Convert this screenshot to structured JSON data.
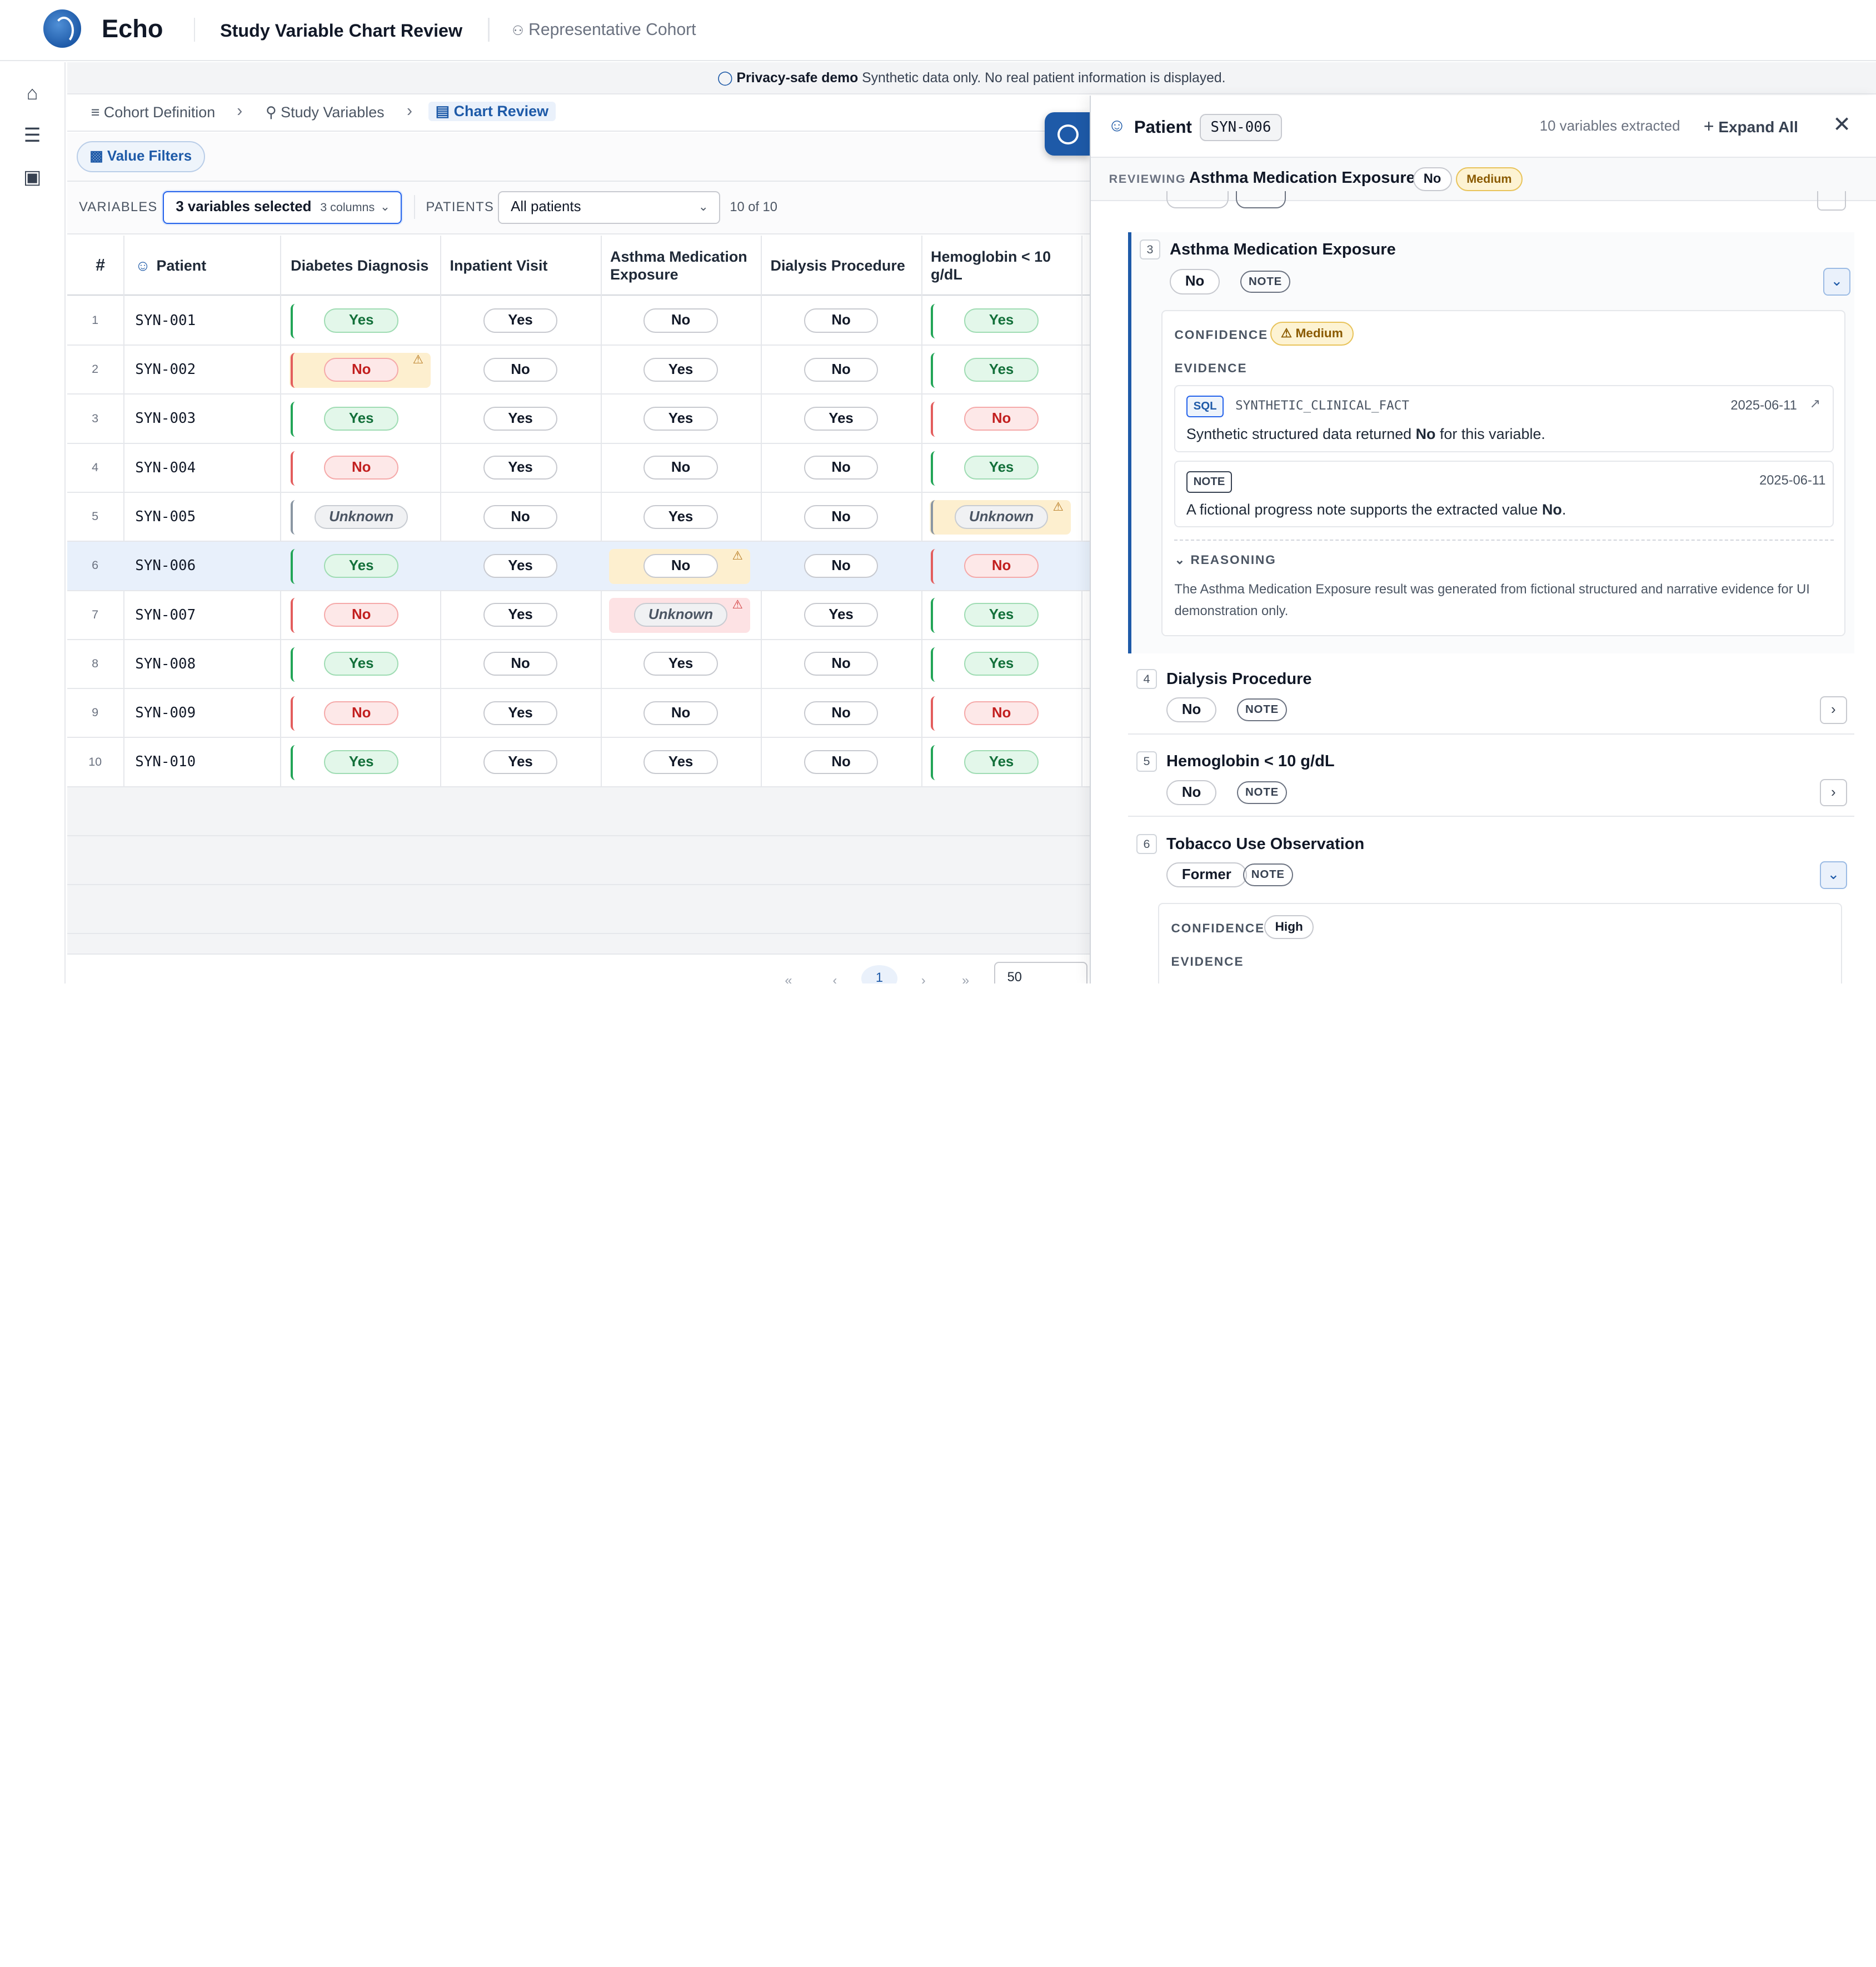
{
  "header": {
    "brand": "Echo",
    "title": "Study Variable Chart Review",
    "cohort": "Representative Cohort"
  },
  "rail": {
    "icons": [
      "home-icon",
      "list-icon",
      "briefcase-icon"
    ]
  },
  "banner": {
    "bold": "Privacy-safe demo",
    "text": "Synthetic data only. No real patient information is displayed."
  },
  "breadcrumbs": [
    "Cohort Definition",
    "Study Variables",
    "Chart Review"
  ],
  "filters": {
    "value_filters": "Value Filters"
  },
  "controls": {
    "variables_label": "VARIABLES",
    "variables_value": "3 variables selected",
    "variables_sub": "3 columns",
    "patients_label": "PATIENTS",
    "patients_value": "All patients",
    "count": "10 of 10"
  },
  "table": {
    "headers": [
      "#",
      "Patient",
      "Diabetes Diagnosis",
      "Inpatient Visit",
      "Asthma Medication Exposure",
      "Dialysis Procedure",
      "Hemoglobin < 10 g/dL"
    ],
    "rows": [
      {
        "n": "1",
        "id": "SYN-001",
        "v": [
          "Yes",
          "Yes",
          "No",
          "No",
          "Yes"
        ]
      },
      {
        "n": "2",
        "id": "SYN-002",
        "v": [
          "No",
          "No",
          "Yes",
          "No",
          "Yes"
        ]
      },
      {
        "n": "3",
        "id": "SYN-003",
        "v": [
          "Yes",
          "Yes",
          "Yes",
          "Yes",
          "No"
        ]
      },
      {
        "n": "4",
        "id": "SYN-004",
        "v": [
          "No",
          "Yes",
          "No",
          "No",
          "Yes"
        ]
      },
      {
        "n": "5",
        "id": "SYN-005",
        "v": [
          "Unknown",
          "No",
          "Yes",
          "No",
          "Unknown"
        ]
      },
      {
        "n": "6",
        "id": "SYN-006",
        "v": [
          "Yes",
          "Yes",
          "No",
          "No",
          "No"
        ]
      },
      {
        "n": "7",
        "id": "SYN-007",
        "v": [
          "No",
          "Yes",
          "Unknown",
          "Yes",
          "Yes"
        ]
      },
      {
        "n": "8",
        "id": "SYN-008",
        "v": [
          "Yes",
          "No",
          "Yes",
          "No",
          "Yes"
        ]
      },
      {
        "n": "9",
        "id": "SYN-009",
        "v": [
          "No",
          "Yes",
          "No",
          "No",
          "No"
        ]
      },
      {
        "n": "10",
        "id": "SYN-010",
        "v": [
          "Yes",
          "Yes",
          "Yes",
          "No",
          "Yes"
        ]
      }
    ],
    "page_size": "50",
    "current_page": "1"
  },
  "panel": {
    "title": "Patient",
    "patient_id": "SYN-006",
    "vars_count": "10 variables extracted",
    "expand_all": "Expand All",
    "reviewing_label": "REVIEWING",
    "reviewing_title": "Asthma Medication Exposure",
    "reviewing_value": "No",
    "reviewing_confidence": "Medium",
    "items": [
      {
        "n": "3",
        "title": "Asthma Medication Exposure",
        "value": "No",
        "note": "NOTE"
      },
      {
        "n": "4",
        "title": "Dialysis Procedure",
        "value": "No",
        "note": "NOTE"
      },
      {
        "n": "5",
        "title": "Hemoglobin < 10 g/dL",
        "value": "No",
        "note": "NOTE"
      },
      {
        "n": "6",
        "title": "Tobacco Use Observation",
        "value": "Former",
        "note": "NOTE"
      }
    ],
    "detail": {
      "confidence_label": "CONFIDENCE",
      "confidence": "Medium",
      "evidence_label": "EVIDENCE",
      "ev1_tag": "SQL",
      "ev1_source": "SYNTHETIC_CLINICAL_FACT",
      "ev1_date": "2025-06-11",
      "ev1_pre": "Synthetic structured data returned ",
      "ev1_bold": "No",
      "ev1_post": " for this variable.",
      "ev2_tag": "NOTE",
      "ev2_date": "2025-06-11",
      "ev2_pre": "A fictional progress note supports the extracted value ",
      "ev2_bold": "No",
      "ev2_post": ".",
      "reasoning_label": "REASONING",
      "reasoning": "The Asthma Medication Exposure result was generated from fictional structured and narrative evidence for UI demonstration only."
    },
    "detail2": {
      "confidence_label": "CONFIDENCE",
      "confidence": "High",
      "evidence_label": "EVIDENCE"
    }
  },
  "colors": {
    "accent": "#1e5aa8",
    "yes": "#13703a",
    "no": "#c21f1f",
    "warning": "#b7791f"
  }
}
